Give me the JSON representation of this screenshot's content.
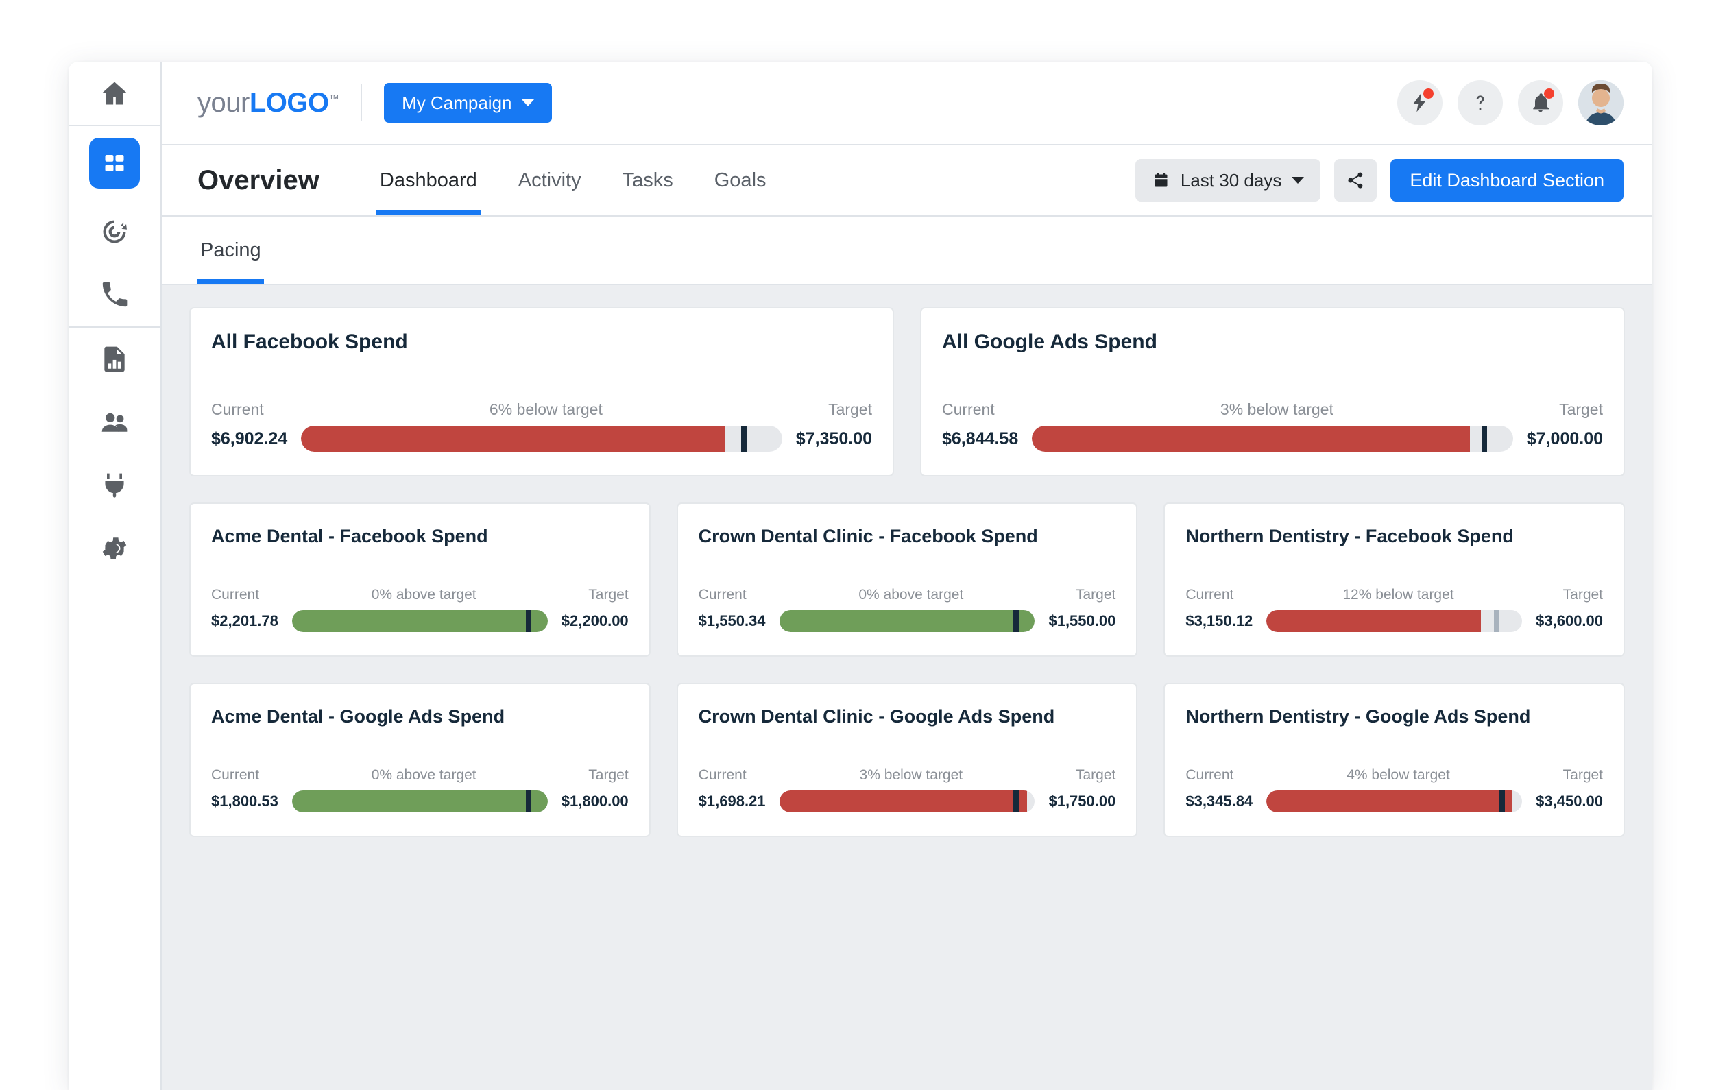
{
  "sidebar": {
    "groups": [
      {
        "items": [
          {
            "name": "home",
            "icon": "home-icon",
            "active": false
          }
        ]
      },
      {
        "items": [
          {
            "name": "dashboard",
            "icon": "dashboard-grid-icon",
            "active": true
          },
          {
            "name": "targeting",
            "icon": "target-icon",
            "active": false
          },
          {
            "name": "calls",
            "icon": "phone-icon",
            "active": false
          }
        ]
      },
      {
        "items": [
          {
            "name": "reports",
            "icon": "report-chart-icon",
            "active": false
          },
          {
            "name": "contacts",
            "icon": "people-icon",
            "active": false
          },
          {
            "name": "integrations",
            "icon": "plug-icon",
            "active": false
          },
          {
            "name": "settings",
            "icon": "gear-icon",
            "active": false
          }
        ]
      }
    ]
  },
  "header": {
    "logo_light": "your",
    "logo_bold": "LOGO",
    "logo_tm": "™",
    "campaign_label": "My Campaign",
    "actions": [
      {
        "name": "quick-actions",
        "icon": "lightning-icon",
        "badge": true
      },
      {
        "name": "help",
        "icon": "question-mark-icon",
        "badge": false
      },
      {
        "name": "notifications",
        "icon": "bell-icon",
        "badge": true
      }
    ],
    "avatar_name": "user-avatar"
  },
  "nav": {
    "page_title": "Overview",
    "tabs": [
      {
        "label": "Dashboard",
        "active": true
      },
      {
        "label": "Activity",
        "active": false
      },
      {
        "label": "Tasks",
        "active": false
      },
      {
        "label": "Goals",
        "active": false
      }
    ],
    "date_range": "Last 30 days",
    "share_icon": "share-icon",
    "calendar_icon": "calendar-icon",
    "edit_button": "Edit Dashboard Section",
    "subtabs": [
      {
        "label": "Pacing",
        "active": true
      }
    ]
  },
  "labels": {
    "current": "Current",
    "target": "Target"
  },
  "colors": {
    "accent": "#1779f3",
    "over_target": "#6f9e59",
    "under_target": "#c0453f",
    "track": "#e6e8eb",
    "marker_dark": "#16293a",
    "marker_light": "#a8b2bd"
  },
  "chart_data": {
    "type": "bar",
    "title": "Pacing",
    "cards": [
      {
        "title": "All Facebook Spend",
        "current_label": "$6,902.24",
        "target_label": "$7,350.00",
        "status": "6% below target",
        "current": 6902.24,
        "target": 7350.0,
        "fill_pct": 88,
        "marker_pct": 91.5,
        "state": "under",
        "marker_style": "dark",
        "size": "wide"
      },
      {
        "title": "All Google Ads Spend",
        "current_label": "$6,844.58",
        "target_label": "$7,000.00",
        "status": "3% below target",
        "current": 6844.58,
        "target": 7000.0,
        "fill_pct": 91,
        "marker_pct": 93.5,
        "state": "under",
        "marker_style": "dark",
        "size": "wide"
      },
      {
        "title": "Acme Dental - Facebook Spend",
        "current_label": "$2,201.78",
        "target_label": "$2,200.00",
        "status": "0% above target",
        "current": 2201.78,
        "target": 2200.0,
        "fill_pct": 100,
        "marker_pct": 91.5,
        "state": "over",
        "marker_style": "dark",
        "size": "small"
      },
      {
        "title": "Crown Dental Clinic - Facebook Spend",
        "current_label": "$1,550.34",
        "target_label": "$1,550.00",
        "status": "0% above target",
        "current": 1550.34,
        "target": 1550.0,
        "fill_pct": 100,
        "marker_pct": 91.5,
        "state": "over",
        "marker_style": "dark",
        "size": "small"
      },
      {
        "title": "Northern Dentistry - Facebook Spend",
        "current_label": "$3,150.12",
        "target_label": "$3,600.00",
        "status": "12% below target",
        "current": 3150.12,
        "target": 3600.0,
        "fill_pct": 84,
        "marker_pct": 89,
        "state": "under",
        "marker_style": "light",
        "size": "small"
      },
      {
        "title": "Acme Dental - Google Ads Spend",
        "current_label": "$1,800.53",
        "target_label": "$1,800.00",
        "status": "0% above target",
        "current": 1800.53,
        "target": 1800.0,
        "fill_pct": 100,
        "marker_pct": 91.5,
        "state": "over",
        "marker_style": "dark",
        "size": "small"
      },
      {
        "title": "Crown Dental Clinic - Google Ads Spend",
        "current_label": "$1,698.21",
        "target_label": "$1,750.00",
        "status": "3% below target",
        "current": 1698.21,
        "target": 1750.0,
        "fill_pct": 97,
        "marker_pct": 91.5,
        "state": "under",
        "marker_style": "dark",
        "size": "small"
      },
      {
        "title": "Northern Dentistry - Google Ads Spend",
        "current_label": "$3,345.84",
        "target_label": "$3,450.00",
        "status": "4% below target",
        "current": 3345.84,
        "target": 3450.0,
        "fill_pct": 96,
        "marker_pct": 91,
        "state": "under",
        "marker_style": "dark",
        "size": "small"
      }
    ]
  }
}
